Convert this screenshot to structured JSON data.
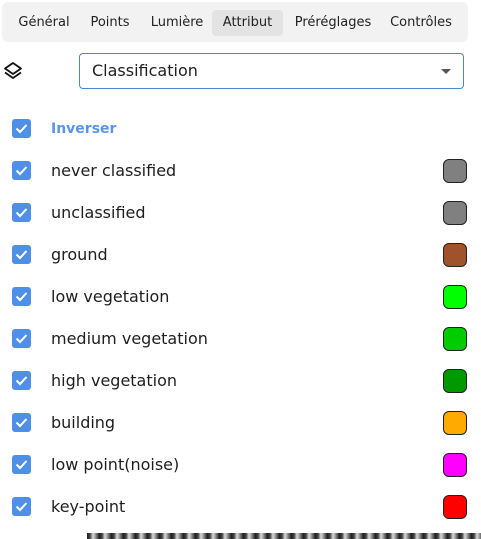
{
  "tabs": [
    {
      "label": "Général"
    },
    {
      "label": "Points"
    },
    {
      "label": "Lumière"
    },
    {
      "label": "Attribut",
      "active": true
    },
    {
      "label": "Préréglages"
    },
    {
      "label": "Contrôles"
    }
  ],
  "attribute_select": {
    "value": "Classification"
  },
  "classification": {
    "toggle_all": {
      "label": "Inverser",
      "checked": true
    },
    "items": [
      {
        "label": "never classified",
        "checked": true,
        "color": "#808080"
      },
      {
        "label": "unclassified",
        "checked": true,
        "color": "#808080"
      },
      {
        "label": "ground",
        "checked": true,
        "color": "#a0522d"
      },
      {
        "label": "low vegetation",
        "checked": true,
        "color": "#00ff00"
      },
      {
        "label": "medium vegetation",
        "checked": true,
        "color": "#00cc00"
      },
      {
        "label": "high vegetation",
        "checked": true,
        "color": "#009900"
      },
      {
        "label": "building",
        "checked": true,
        "color": "#ffaa00"
      },
      {
        "label": "low point(noise)",
        "checked": true,
        "color": "#ff00ff"
      },
      {
        "label": "key-point",
        "checked": true,
        "color": "#ff0000"
      }
    ]
  },
  "colors": {
    "accent": "#4a86d8",
    "checkbox": "#4f8fe8",
    "tab_active_bg": "#e3e3e3",
    "tabbar_bg": "#f2f2f2"
  }
}
